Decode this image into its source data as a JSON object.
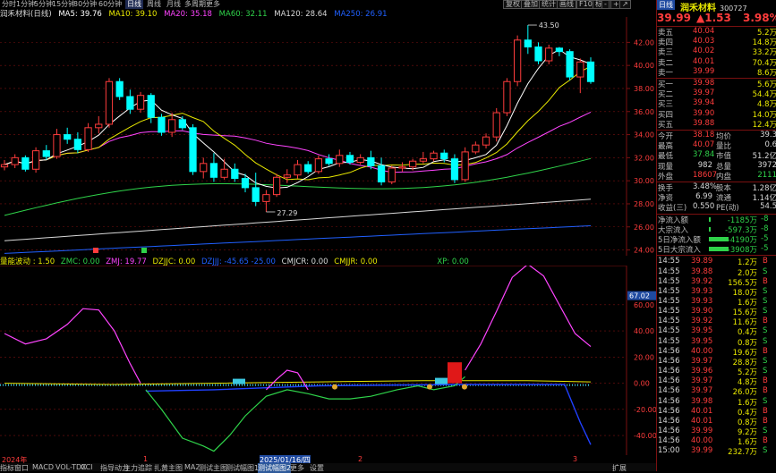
{
  "top_tabs": [
    "分时",
    "1分钟",
    "5分钟",
    "15分钟",
    "30分钟",
    "60分钟",
    "日线",
    "周线",
    "月线",
    "多周期",
    "更多"
  ],
  "top_active_tab": "日线",
  "top_buttons": [
    "复权",
    "叠加",
    "统计",
    "画线",
    "F10",
    "标记",
    "-",
    "+",
    "↗"
  ],
  "title": {
    "name": "润禾材料(日线)",
    "ma5": "MA5: 39.76",
    "ma10": "MA10: 39.10",
    "ma20": "MA20: 35.18",
    "ma60": "MA60: 32.11",
    "ma120": "MA120: 28.64",
    "ma250": "MA250: 26.91"
  },
  "colors": {
    "up": "#ff3c3c",
    "down": "#00ffff",
    "ma5": "#ffffff",
    "ma10": "#e8e800",
    "ma20": "#ff44ff",
    "ma60": "#2fd34a",
    "ma120": "#d8d8d8",
    "ma250": "#2060ff",
    "grid": "#7a1010",
    "axis_text": "#ff3c3c"
  },
  "price_axis": [
    "42.00",
    "40.00",
    "38.00",
    "36.00",
    "34.00",
    "32.00",
    "30.00",
    "28.00",
    "26.00",
    "24.00"
  ],
  "annotations": {
    "high": "43.50",
    "low": "27.29"
  },
  "chart_data": {
    "type": "candlestick",
    "ylim": [
      23.5,
      44.2
    ],
    "y_ticks": [
      42,
      40,
      38,
      36,
      34,
      32,
      30,
      28,
      26,
      24
    ],
    "candles": [
      {
        "o": 31.2,
        "h": 31.8,
        "l": 30.9,
        "c": 31.4
      },
      {
        "o": 31.4,
        "h": 32.3,
        "l": 31.1,
        "c": 32.0
      },
      {
        "o": 32.0,
        "h": 32.2,
        "l": 30.8,
        "c": 31.0
      },
      {
        "o": 31.0,
        "h": 32.9,
        "l": 30.7,
        "c": 32.6
      },
      {
        "o": 32.6,
        "h": 33.1,
        "l": 31.8,
        "c": 32.1
      },
      {
        "o": 32.1,
        "h": 34.5,
        "l": 31.9,
        "c": 34.0
      },
      {
        "o": 34.0,
        "h": 34.6,
        "l": 33.2,
        "c": 33.6
      },
      {
        "o": 33.6,
        "h": 34.2,
        "l": 32.4,
        "c": 32.7
      },
      {
        "o": 32.7,
        "h": 35.0,
        "l": 32.5,
        "c": 34.6
      },
      {
        "o": 34.6,
        "h": 35.6,
        "l": 34.1,
        "c": 34.9
      },
      {
        "o": 34.9,
        "h": 38.9,
        "l": 34.6,
        "c": 38.6
      },
      {
        "o": 38.6,
        "h": 38.9,
        "l": 37.0,
        "c": 37.3
      },
      {
        "o": 37.3,
        "h": 37.9,
        "l": 35.8,
        "c": 36.2
      },
      {
        "o": 36.2,
        "h": 37.7,
        "l": 35.9,
        "c": 37.4
      },
      {
        "o": 37.4,
        "h": 37.6,
        "l": 35.0,
        "c": 35.5
      },
      {
        "o": 35.5,
        "h": 35.8,
        "l": 33.9,
        "c": 34.2
      },
      {
        "o": 34.2,
        "h": 35.9,
        "l": 33.8,
        "c": 35.3
      },
      {
        "o": 35.3,
        "h": 35.6,
        "l": 34.4,
        "c": 34.6
      },
      {
        "o": 34.6,
        "h": 34.9,
        "l": 30.5,
        "c": 30.8
      },
      {
        "o": 30.8,
        "h": 32.0,
        "l": 30.2,
        "c": 31.5
      },
      {
        "o": 31.5,
        "h": 32.4,
        "l": 29.9,
        "c": 30.3
      },
      {
        "o": 30.3,
        "h": 31.9,
        "l": 30.1,
        "c": 31.0
      },
      {
        "o": 31.0,
        "h": 31.5,
        "l": 29.9,
        "c": 30.2
      },
      {
        "o": 30.2,
        "h": 30.6,
        "l": 29.0,
        "c": 29.4
      },
      {
        "o": 29.4,
        "h": 30.7,
        "l": 27.8,
        "c": 28.2
      },
      {
        "o": 28.2,
        "h": 29.2,
        "l": 27.3,
        "c": 28.8
      },
      {
        "o": 28.8,
        "h": 30.6,
        "l": 28.6,
        "c": 30.3
      },
      {
        "o": 30.3,
        "h": 31.0,
        "l": 29.8,
        "c": 30.5
      },
      {
        "o": 30.5,
        "h": 31.8,
        "l": 30.2,
        "c": 31.4
      },
      {
        "o": 31.4,
        "h": 31.7,
        "l": 30.6,
        "c": 30.8
      },
      {
        "o": 30.8,
        "h": 32.2,
        "l": 30.6,
        "c": 31.9
      },
      {
        "o": 31.9,
        "h": 32.3,
        "l": 31.3,
        "c": 31.5
      },
      {
        "o": 31.5,
        "h": 32.7,
        "l": 31.2,
        "c": 32.2
      },
      {
        "o": 32.2,
        "h": 32.5,
        "l": 31.4,
        "c": 31.6
      },
      {
        "o": 31.6,
        "h": 32.3,
        "l": 31.4,
        "c": 32.0
      },
      {
        "o": 32.0,
        "h": 32.6,
        "l": 31.0,
        "c": 31.3
      },
      {
        "o": 31.3,
        "h": 32.0,
        "l": 29.6,
        "c": 29.9
      },
      {
        "o": 29.9,
        "h": 31.3,
        "l": 29.7,
        "c": 31.1
      },
      {
        "o": 31.1,
        "h": 31.6,
        "l": 30.8,
        "c": 31.2
      },
      {
        "o": 31.2,
        "h": 31.9,
        "l": 30.9,
        "c": 31.7
      },
      {
        "o": 31.7,
        "h": 32.5,
        "l": 31.5,
        "c": 31.9
      },
      {
        "o": 31.9,
        "h": 32.6,
        "l": 31.7,
        "c": 32.4
      },
      {
        "o": 32.4,
        "h": 32.7,
        "l": 31.6,
        "c": 31.9
      },
      {
        "o": 31.9,
        "h": 32.3,
        "l": 29.8,
        "c": 30.1
      },
      {
        "o": 30.1,
        "h": 32.9,
        "l": 29.9,
        "c": 32.5
      },
      {
        "o": 32.5,
        "h": 33.4,
        "l": 32.3,
        "c": 33.1
      },
      {
        "o": 33.1,
        "h": 34.1,
        "l": 32.8,
        "c": 33.8
      },
      {
        "o": 33.8,
        "h": 36.3,
        "l": 33.4,
        "c": 35.9
      },
      {
        "o": 35.9,
        "h": 38.9,
        "l": 35.6,
        "c": 38.6
      },
      {
        "o": 38.6,
        "h": 42.6,
        "l": 38.2,
        "c": 42.2
      },
      {
        "o": 42.2,
        "h": 43.5,
        "l": 41.0,
        "c": 41.6
      },
      {
        "o": 41.6,
        "h": 42.0,
        "l": 40.1,
        "c": 40.4
      },
      {
        "o": 40.4,
        "h": 41.8,
        "l": 40.1,
        "c": 41.5
      },
      {
        "o": 41.5,
        "h": 41.6,
        "l": 40.8,
        "c": 41.2
      },
      {
        "o": 41.2,
        "h": 41.4,
        "l": 38.7,
        "c": 39.0
      },
      {
        "o": 39.0,
        "h": 40.6,
        "l": 37.6,
        "c": 40.3
      },
      {
        "o": 40.3,
        "h": 40.7,
        "l": 38.4,
        "c": 38.6
      }
    ]
  },
  "sub_legend": {
    "a": "量能波动 : 1.50",
    "zmc": "ZMC: 0.00",
    "zmj": "ZMJ: 19.77",
    "dzjjc": "DZJJC: 0.00",
    "dzjjj": "DZJJJ: -45.65  -25.00",
    "cmjcr": "CMJCR: 0.00",
    "cmjjr": "CMJJR: 0.00",
    "xp": "XP: 0.00"
  },
  "sub_axis": [
    "60.00",
    "40.00",
    "20.00",
    "0.00",
    "-20.00",
    "-40.00"
  ],
  "sub_tag": "67.02",
  "sub_chart_data": {
    "type": "line",
    "ylim": [
      -55,
      90
    ],
    "y_ticks": [
      60,
      40,
      20,
      0,
      -20,
      -40
    ],
    "magenta": [
      [
        0,
        38
      ],
      [
        4,
        30
      ],
      [
        8,
        34
      ],
      [
        12,
        45
      ],
      [
        15,
        57
      ],
      [
        18,
        56
      ],
      [
        21,
        40
      ],
      [
        24,
        15
      ],
      [
        26,
        0
      ]
    ],
    "magenta_b": [
      [
        50,
        -5
      ],
      [
        52,
        3
      ],
      [
        54,
        10
      ],
      [
        56,
        8
      ],
      [
        58,
        -5
      ]
    ],
    "magenta_c": [
      [
        88,
        10
      ],
      [
        91,
        30
      ],
      [
        94,
        55
      ],
      [
        97,
        81
      ],
      [
        100,
        91
      ],
      [
        103,
        82
      ],
      [
        106,
        60
      ],
      [
        109,
        38
      ],
      [
        112,
        28
      ]
    ],
    "green": [
      [
        27,
        -5
      ],
      [
        30,
        -20
      ],
      [
        34,
        -42
      ],
      [
        38,
        -48
      ],
      [
        40,
        -52
      ],
      [
        43,
        -40
      ],
      [
        46,
        -25
      ],
      [
        50,
        -10
      ],
      [
        54,
        -5
      ],
      [
        58,
        -8
      ],
      [
        62,
        -12
      ],
      [
        66,
        -12
      ],
      [
        70,
        -10
      ],
      [
        75,
        -5
      ],
      [
        79,
        -2
      ],
      [
        82,
        -5
      ],
      [
        86,
        -2
      ],
      [
        88,
        5
      ]
    ],
    "blue": [
      [
        27,
        -6
      ],
      [
        40,
        -5
      ],
      [
        60,
        -2
      ],
      [
        86,
        -1
      ],
      [
        107,
        -1
      ],
      [
        110,
        -30
      ],
      [
        112,
        -47
      ]
    ],
    "yellow": [
      [
        0,
        0
      ],
      [
        20,
        -1
      ],
      [
        40,
        0
      ],
      [
        60,
        1
      ],
      [
        80,
        2
      ],
      [
        100,
        2
      ],
      [
        112,
        1
      ]
    ]
  },
  "date_labels": [
    "2024年",
    "1",
    "2025/01/16/四",
    "2",
    "3"
  ],
  "bottom_tabs": [
    "指标",
    "窗口",
    "MACD",
    "VOL-TDX",
    "CCI",
    "指导动力",
    "主力追踪",
    "扎黄主图",
    "MA2",
    "测试主图",
    "测试幅图1",
    "测试幅图2",
    "更多",
    "设置"
  ],
  "bottom_active": "测试幅图2",
  "right_tabs": [
    "扩展",
    "日线"
  ],
  "quote": {
    "title": "润禾材料",
    "code": "300727",
    "price": "39.99",
    "change": "▲1.53",
    "pct": "3.98%",
    "asks": [
      {
        "label": "卖五",
        "price": "40.04",
        "vol": "5.2万"
      },
      {
        "label": "卖四",
        "price": "40.03",
        "vol": "14.8万"
      },
      {
        "label": "卖三",
        "price": "40.02",
        "vol": "33.2万"
      },
      {
        "label": "卖二",
        "price": "40.01",
        "vol": "70.4万"
      },
      {
        "label": "卖一",
        "price": "39.99",
        "vol": "8.6万"
      }
    ],
    "bids": [
      {
        "label": "买一",
        "price": "39.98",
        "vol": "5.6万"
      },
      {
        "label": "买二",
        "price": "39.97",
        "vol": "54.4万"
      },
      {
        "label": "买三",
        "price": "39.94",
        "vol": "4.8万"
      },
      {
        "label": "买四",
        "price": "39.90",
        "vol": "14.0万"
      },
      {
        "label": "买五",
        "price": "39.88",
        "vol": "12.4万"
      }
    ],
    "stats": [
      [
        "今开",
        "38.18",
        "均价",
        "39.3"
      ],
      [
        "最高",
        "40.07",
        "量比",
        "0.6"
      ],
      [
        "最低",
        "37.84",
        "市值",
        "51.2亿"
      ],
      [
        "现量",
        "982",
        "总量",
        "3972"
      ],
      [
        "外盘",
        "18607",
        "内盘",
        "2111"
      ]
    ],
    "stats2": [
      [
        "换手",
        "3.48%",
        "股本",
        "1.28亿"
      ],
      [
        "净资",
        "6.99",
        "流通",
        "1.14亿"
      ],
      [
        "收益(三)",
        "0.550",
        "PE(动)",
        "54.5"
      ]
    ],
    "flows": [
      {
        "label": "净流入额",
        "val": "-1185万",
        "pct": "-8"
      },
      {
        "label": "大宗流入",
        "val": "-597.3万",
        "pct": "-8"
      },
      {
        "label": "5日净流入额",
        "val": "-4190万",
        "pct": "-5"
      },
      {
        "label": "5日大宗流入",
        "val": "-3908万",
        "pct": "-5"
      }
    ],
    "ticks": [
      [
        "14:55",
        "39.89",
        "1.2万",
        "B"
      ],
      [
        "14:55",
        "39.88",
        "2.0万",
        "S"
      ],
      [
        "14:55",
        "39.92",
        "156.5万",
        "B"
      ],
      [
        "14:55",
        "39.93",
        "18.0万",
        "S"
      ],
      [
        "14:55",
        "39.93",
        "1.6万",
        "S"
      ],
      [
        "14:55",
        "39.90",
        "15.6万",
        "S"
      ],
      [
        "14:55",
        "39.92",
        "11.6万",
        "B"
      ],
      [
        "14:55",
        "39.95",
        "0.4万",
        "S"
      ],
      [
        "14:55",
        "39.95",
        "0.8万",
        "S"
      ],
      [
        "14:56",
        "40.00",
        "19.6万",
        "B"
      ],
      [
        "14:56",
        "39.97",
        "28.8万",
        "S"
      ],
      [
        "14:56",
        "39.96",
        "5.2万",
        "S"
      ],
      [
        "14:56",
        "39.97",
        "4.8万",
        "B"
      ],
      [
        "14:56",
        "39.97",
        "26.0万",
        "B"
      ],
      [
        "14:56",
        "39.98",
        "1.6万",
        "S"
      ],
      [
        "14:56",
        "40.01",
        "0.4万",
        "B"
      ],
      [
        "14:56",
        "40.01",
        "0.8万",
        "B"
      ],
      [
        "14:56",
        "39.99",
        "9.2万",
        "S"
      ],
      [
        "14:56",
        "40.00",
        "1.6万",
        "B"
      ],
      [
        "15:00",
        "39.99",
        "232.7万",
        "S"
      ]
    ]
  }
}
